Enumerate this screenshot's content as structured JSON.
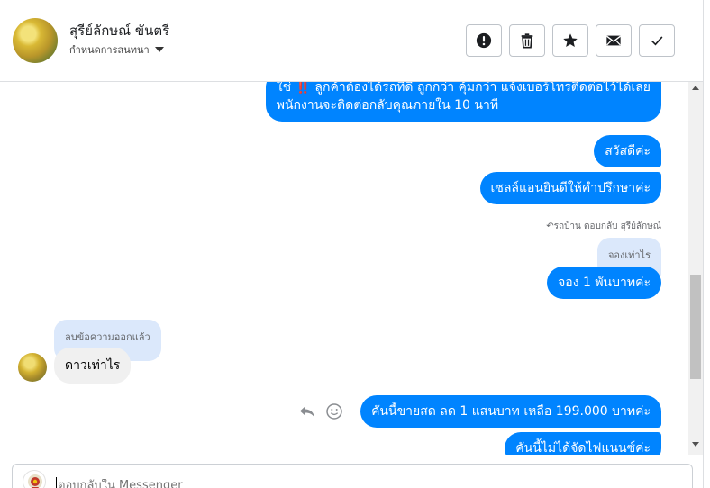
{
  "header": {
    "contact_name": "สุรีย์ลักษณ์ ขันตรี",
    "assign_label": "กำหนดการสนทนา",
    "actions": [
      {
        "name": "mark-spam-button",
        "icon": "alert-circle-icon"
      },
      {
        "name": "delete-button",
        "icon": "trash-icon"
      },
      {
        "name": "star-button",
        "icon": "star-icon"
      },
      {
        "name": "mark-unread-button",
        "icon": "envelope-icon"
      },
      {
        "name": "mark-done-button",
        "icon": "check-icon"
      }
    ]
  },
  "messages": {
    "m1_line1": "ใช่ ‼️ ลูกค้าต้องได้รถที่ดี ถูกกว่า คุ้มกว่า แจ้งเบอร์โทรติดต่อไว้ได้เลย",
    "m1_line2": "พนักงานจะติดต่อกลับคุณภายใน 10 นาที",
    "m2": "สวัสดีค่ะ",
    "m3": "เซลล์แอนยินดีให้คำปรึกษาค่ะ",
    "reply_meta": "รถบ้าน ตอบกลับ สุรีย์ลักษณ์",
    "quoted_text": "จองเท่าไร",
    "m4": "จอง 1 พันบาทค่ะ",
    "deleted_quote": "ลบข้อความออกแล้ว",
    "m5": "ดาวเท่าไร",
    "m6": "คันนี้ขายสด ลด 1 แสนบาท เหลือ 199.000 บาทค่ะ",
    "m7": "คันนี้ไม่ได้จัดไฟแนนซ์ค่ะ"
  },
  "composer": {
    "placeholder": "ตอบกลับใน Messenger"
  },
  "colors": {
    "outgoing_bubble": "#0084ff",
    "incoming_bubble": "#f0f0f0",
    "quote_bubble": "#dbe8fb"
  }
}
